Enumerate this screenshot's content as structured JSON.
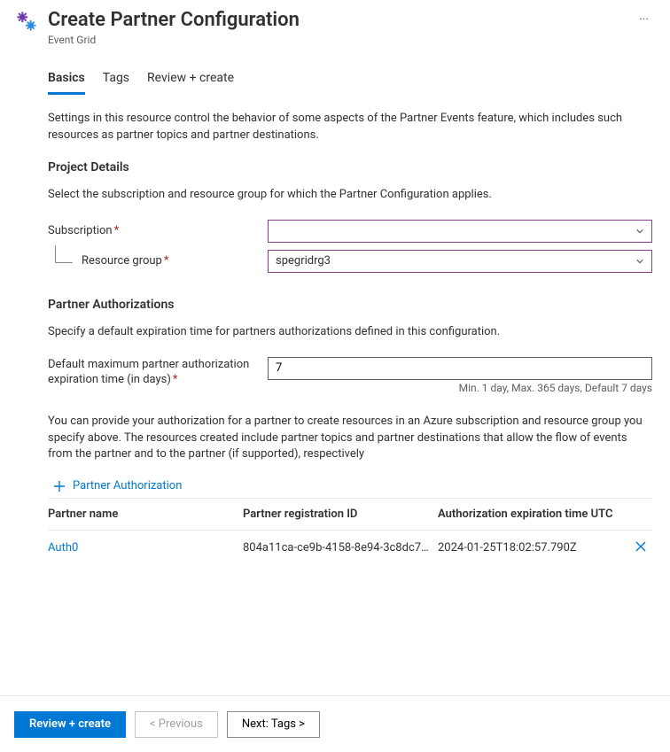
{
  "header": {
    "title": "Create Partner Configuration",
    "subtitle": "Event Grid",
    "ellipsis": "···"
  },
  "tabs": [
    {
      "label": "Basics",
      "active": true
    },
    {
      "label": "Tags",
      "active": false
    },
    {
      "label": "Review + create",
      "active": false
    }
  ],
  "intro": "Settings in this resource control the behavior of some aspects of the Partner Events feature, which includes such resources as partner topics and partner destinations.",
  "project": {
    "title": "Project Details",
    "desc": "Select the subscription and resource group for which the Partner Configuration applies.",
    "subscription_label": "Subscription",
    "subscription_value": "",
    "resource_group_label": "Resource group",
    "resource_group_value": "spegridrg3"
  },
  "auth": {
    "title": "Partner Authorizations",
    "desc": "Specify a default expiration time for partners authorizations defined in this configuration.",
    "exp_label": "Default maximum partner authorization expiration time (in days)",
    "exp_value": "7",
    "exp_hint": "Min. 1 day, Max. 365 days, Default 7 days",
    "long_desc": "You can provide your authorization for a partner to create resources in an Azure subscription and resource group you specify above. The resources created include partner topics and partner destinations that allow the flow of events from the partner and to the partner (if supported), respectively",
    "add_label": "Partner Authorization",
    "columns": {
      "name": "Partner name",
      "regid": "Partner registration ID",
      "expire": "Authorization expiration time UTC"
    },
    "rows": [
      {
        "name": "Auth0",
        "regid": "804a11ca-ce9b-4158-8e94-3c8dc7…",
        "expire": "2024-01-25T18:02:57.790Z"
      }
    ]
  },
  "footer": {
    "review": "Review + create",
    "previous": "< Previous",
    "next": "Next: Tags >"
  }
}
